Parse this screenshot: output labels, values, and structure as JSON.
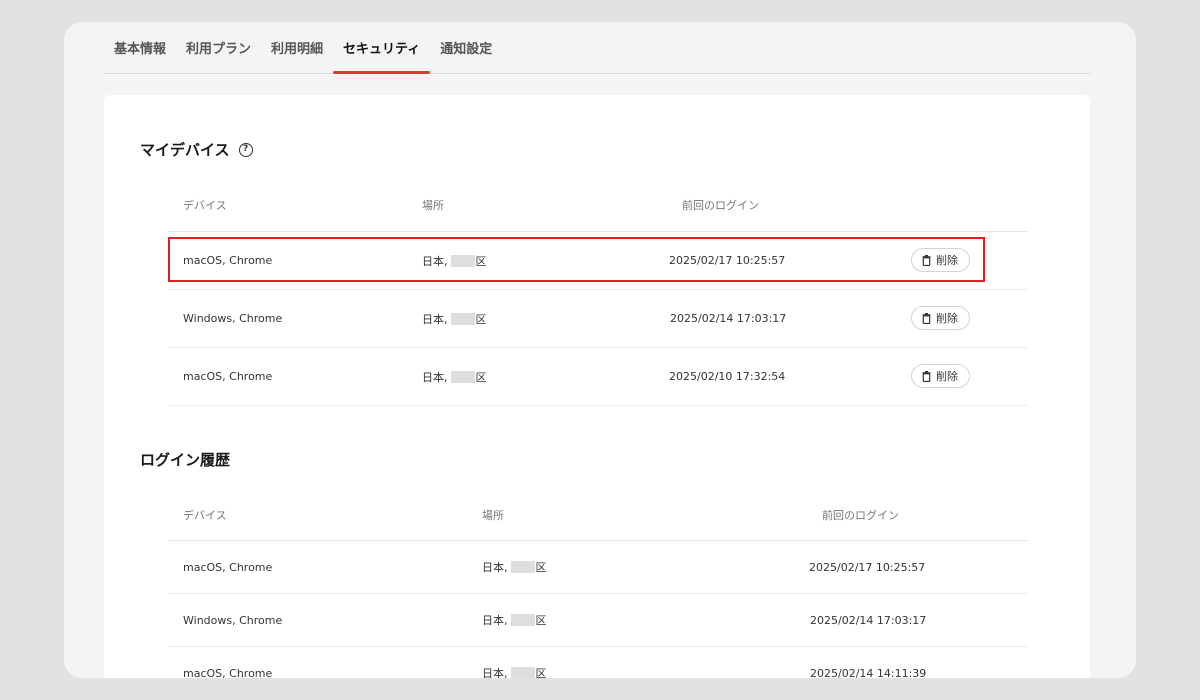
{
  "tabs": [
    {
      "label": "基本情報"
    },
    {
      "label": "利用プラン"
    },
    {
      "label": "利用明細"
    },
    {
      "label": "セキュリティ"
    },
    {
      "label": "通知設定"
    }
  ],
  "active_tab": "セキュリティ",
  "accent_color": "#e0382f",
  "my_devices": {
    "title": "マイデバイス",
    "help_icon": "?",
    "headers": {
      "device": "デバイス",
      "location": "場所",
      "last_login": "前回のログイン"
    },
    "delete_label": "削除",
    "rows": [
      {
        "device": "macOS, Chrome",
        "location_prefix": "日本,",
        "location_suffix": "区",
        "last_login": "2025/02/17 10:25:57",
        "highlighted": true
      },
      {
        "device": "Windows, Chrome",
        "location_prefix": "日本,",
        "location_suffix": "区",
        "last_login": "2025/02/14 17:03:17"
      },
      {
        "device": "macOS, Chrome",
        "location_prefix": "日本,",
        "location_suffix": "区",
        "last_login": "2025/02/10 17:32:54"
      }
    ]
  },
  "login_history": {
    "title": "ログイン履歴",
    "headers": {
      "device": "デバイス",
      "location": "場所",
      "last_login": "前回のログイン"
    },
    "rows": [
      {
        "device": "macOS, Chrome",
        "location_prefix": "日本,",
        "location_suffix": "区",
        "last_login": "2025/02/17 10:25:57"
      },
      {
        "device": "Windows, Chrome",
        "location_prefix": "日本,",
        "location_suffix": "区",
        "last_login": "2025/02/14 17:03:17"
      },
      {
        "device": "macOS, Chrome",
        "location_prefix": "日本,",
        "location_suffix": "区",
        "last_login": "2025/02/14 14:11:39"
      }
    ]
  }
}
